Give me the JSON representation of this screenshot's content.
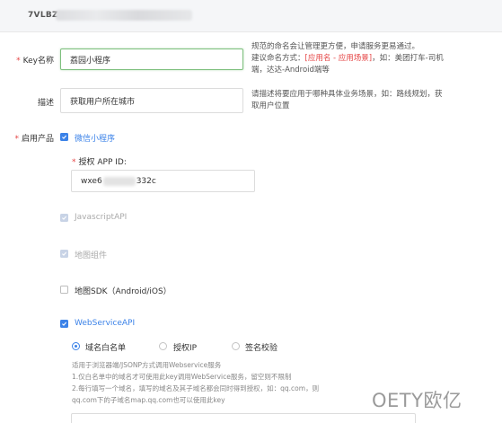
{
  "header": {
    "key_id": "7VLBZ"
  },
  "form": {
    "key_name": {
      "label": "Key名称",
      "value": "荔园小程序",
      "hint_line1": "规范的命名会让管理更方便，申请服务更易通过。",
      "hint_line2_prefix": "建议命名方式：",
      "hint_line2_red": "[应用名 - 应用场景]",
      "hint_line2_suffix": "，如：美团打车-司机",
      "hint_line3": "端，达达-Android端等"
    },
    "description": {
      "label": "描述",
      "value": "获取用户所在城市",
      "hint_line1": "请描述将要应用于哪种具体业务场景，如：路线规划，获",
      "hint_line2": "取用户位置"
    },
    "products": {
      "label": "启用产品",
      "mini_program": {
        "label": "微信小程序",
        "appid_label": "授权 APP ID:",
        "appid_prefix": "wxe6",
        "appid_suffix": "332c"
      },
      "javascript_api": "JavascriptAPI",
      "map_component": "地图组件",
      "map_sdk": "地图SDK（Android/iOS）",
      "webservice_api": {
        "label": "WebServiceAPI",
        "options": [
          "域名白名单",
          "授权IP",
          "签名校验"
        ],
        "selected": "域名白名单",
        "desc_line1": "适用于浏览器端/JSONP方式调用Webservice服务",
        "desc_line2": "1.仅白名单中的域名才可使用此key调用WebService服务，留空则不限制",
        "desc_line3": "2.每行填写一个域名，填写的域名及其子域名都会同时得到授权，如：qq.com，则",
        "desc_line4": "qq.com下的子域名map.qq.com也可以使用此key"
      }
    }
  },
  "watermark": "OETY欧亿",
  "colors": {
    "accent": "#3b82e8",
    "required": "#e54545",
    "focus_border": "#7ec07e"
  }
}
